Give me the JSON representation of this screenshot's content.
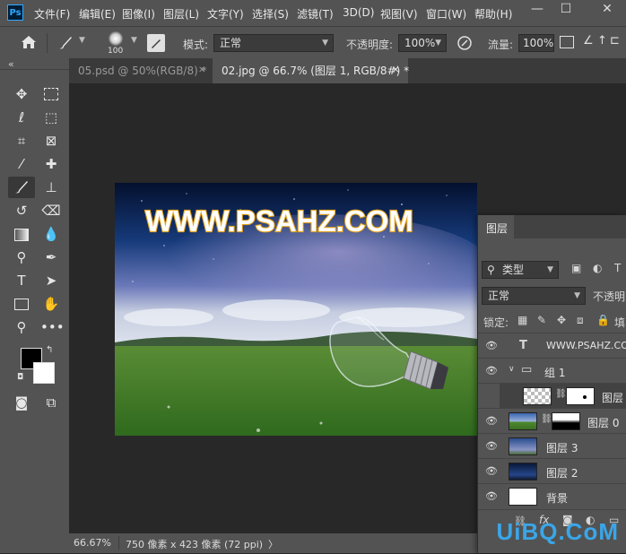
{
  "menubar": {
    "logo": "Ps",
    "items": [
      "文件(F)",
      "编辑(E)",
      "图像(I)",
      "图层(L)",
      "文字(Y)",
      "选择(S)",
      "滤镜(T)",
      "3D(D)",
      "视图(V)",
      "窗口(W)",
      "帮助(H)"
    ],
    "minimize": "—",
    "restore": "☐",
    "close": "✕"
  },
  "options": {
    "brush_size": "100",
    "mode_label": "模式:",
    "mode_value": "正常",
    "opacity_label": "不透明度:",
    "opacity_value": "100%",
    "flow_label": "流量:",
    "flow_value": "100%"
  },
  "tabs": [
    {
      "label": "05.psd @ 50%(RGB/8) *",
      "close": "✕"
    },
    {
      "label": "02.jpg @ 66.7% (图层 1, RGB/8#) *",
      "close": "✕"
    }
  ],
  "toolbar_collapse": "«",
  "image": {
    "banner_text": "WWW.PSAHZ.COM"
  },
  "status": {
    "zoom": "66.67%",
    "doc_info": "750 像素 x 423 像素 (72 ppi)",
    "arrow": "〉"
  },
  "layers_panel": {
    "title": "图层",
    "filter_label": "类型",
    "blend_mode": "正常",
    "opacity_label": "不透明",
    "lock_label": "锁定:",
    "fill_label": "填",
    "layers": [
      {
        "name": "WWW.PSAHZ.COM",
        "kind": "text"
      },
      {
        "name": "组 1",
        "kind": "group"
      },
      {
        "name": "图层",
        "kind": "masked-transparent"
      },
      {
        "name": "图层 0",
        "kind": "masked-landscape"
      },
      {
        "name": "图层 3",
        "kind": "image"
      },
      {
        "name": "图层 2",
        "kind": "image-dark"
      },
      {
        "name": "背景",
        "kind": "background"
      }
    ],
    "bottom_fx": "fx"
  },
  "watermark": "UiBQ.CoM"
}
